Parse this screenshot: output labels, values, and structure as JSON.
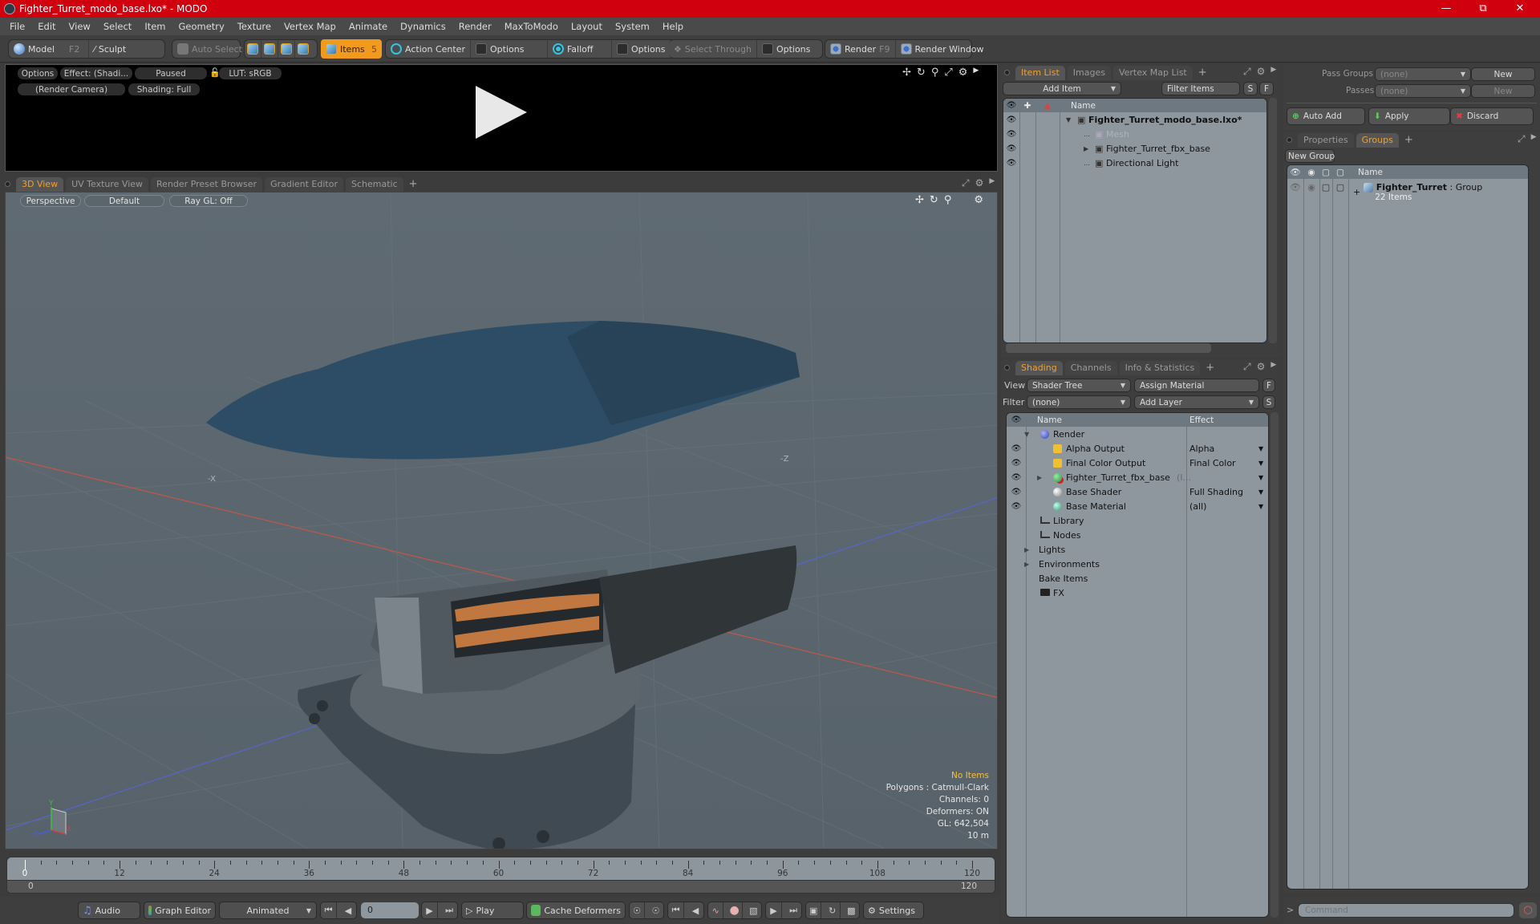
{
  "window": {
    "title": "Fighter_Turret_modo_base.lxo* - MODO",
    "controls": [
      "minimize",
      "restore",
      "close"
    ]
  },
  "menu": [
    "File",
    "Edit",
    "View",
    "Select",
    "Item",
    "Geometry",
    "Texture",
    "Vertex Map",
    "Animate",
    "Dynamics",
    "Render",
    "MaxToModo",
    "Layout",
    "System",
    "Help"
  ],
  "toolbar": {
    "model": {
      "label": "Model",
      "key": "F2"
    },
    "sculpt": {
      "label": "Sculpt"
    },
    "auto_select": "Auto Select",
    "items": {
      "label": "Items",
      "key": "5"
    },
    "action_center": "Action Center",
    "options1": "Options",
    "falloff": "Falloff",
    "options2": "Options",
    "select_through": "Select Through",
    "options3": "Options",
    "render": {
      "label": "Render",
      "key": "F9"
    },
    "render_window": "Render Window"
  },
  "render_preview": {
    "options": "Options",
    "effect": "Effect: (Shadi...",
    "paused": "Paused",
    "lut": "LUT: sRGB",
    "camera": "(Render Camera)",
    "shading": "Shading: Full"
  },
  "viewport_tabs": {
    "tabs": [
      "3D View",
      "UV Texture View",
      "Render Preset Browser",
      "Gradient Editor",
      "Schematic"
    ],
    "active": 0,
    "add": "+"
  },
  "viewport": {
    "projection": "Perspective",
    "style": "Default",
    "raygl": "Ray GL: Off",
    "axis_labels": {
      "x_neg": "-X",
      "z_neg": "-Z"
    },
    "gizmo": {
      "x": "X",
      "y": "Y",
      "z": "Z"
    },
    "stats": {
      "selection": "No Items",
      "polygons": "Polygons : Catmull-Clark",
      "channels": "Channels: 0",
      "deformers": "Deformers: ON",
      "gl": "GL: 642,504",
      "scale": "10 m"
    },
    "colors": {
      "selection_text": "#f5c040",
      "x_axis": "#d05040",
      "z_axis": "#5060d0"
    }
  },
  "timeline": {
    "labels": [
      "0",
      "12",
      "24",
      "36",
      "48",
      "60",
      "72",
      "84",
      "96",
      "108",
      "120"
    ],
    "range_start": "0",
    "range_end": "120",
    "current_frame": 0,
    "max_frame": 120
  },
  "transport": {
    "audio": "Audio",
    "graph_editor": "Graph Editor",
    "animated": "Animated",
    "frame_value": "0",
    "play": "Play",
    "cache_deformers": "Cache Deformers",
    "settings": "Settings"
  },
  "item_list": {
    "tabs": [
      "Item List",
      "Images",
      "Vertex Map List"
    ],
    "active": 0,
    "add_item": "Add Item",
    "filter": "Filter Items",
    "s": "S",
    "f": "F",
    "column_name": "Name",
    "items": [
      {
        "name": "Fighter_Turret_modo_base.lxo*",
        "bold": true,
        "expanded": true,
        "depth": 0
      },
      {
        "name": "Mesh",
        "dim": true,
        "depth": 1
      },
      {
        "name": "Fighter_Turret_fbx_base",
        "collapsed": true,
        "depth": 1
      },
      {
        "name": "Directional Light",
        "depth": 1
      }
    ]
  },
  "shading": {
    "tabs": [
      "Shading",
      "Channels",
      "Info & Statistics"
    ],
    "active": 0,
    "view_label": "View",
    "view_value": "Shader Tree",
    "assign_material": "Assign Material",
    "f": "F",
    "filter_label": "Filter",
    "filter_value": "(none)",
    "add_layer": "Add Layer",
    "s": "S",
    "col_name": "Name",
    "col_effect": "Effect",
    "rows": [
      {
        "name": "Render",
        "effect": "",
        "icon": "render-sphere",
        "eye": false,
        "depth": 0,
        "expanded": true
      },
      {
        "name": "Alpha Output",
        "effect": "Alpha",
        "icon": "output",
        "eye": true,
        "depth": 1
      },
      {
        "name": "Final Color Output",
        "effect": "Final Color",
        "icon": "output",
        "eye": true,
        "depth": 1
      },
      {
        "name": "Fighter_Turret_fbx_base",
        "suffix": "(I...",
        "effect": "",
        "icon": "material-group",
        "eye": true,
        "depth": 1,
        "collapsed": true
      },
      {
        "name": "Base Shader",
        "effect": "Full Shading",
        "icon": "shader",
        "eye": true,
        "depth": 1
      },
      {
        "name": "Base Material",
        "effect": "(all)",
        "icon": "material",
        "eye": true,
        "depth": 1
      },
      {
        "name": "Library",
        "effect": "",
        "icon": "folder",
        "eye": false,
        "depth": 0
      },
      {
        "name": "Nodes",
        "effect": "",
        "icon": "folder",
        "eye": false,
        "depth": 0
      },
      {
        "name": "Lights",
        "effect": "",
        "icon": "",
        "eye": false,
        "depth": -1,
        "collapsed": true
      },
      {
        "name": "Environments",
        "effect": "",
        "icon": "",
        "eye": false,
        "depth": -1,
        "collapsed": true
      },
      {
        "name": "Bake Items",
        "effect": "",
        "icon": "",
        "eye": false,
        "depth": -1
      },
      {
        "name": "FX",
        "effect": "",
        "icon": "clapper",
        "eye": false,
        "depth": 0
      }
    ]
  },
  "pass_groups": {
    "pass_groups_label": "Pass Groups",
    "pass_groups_value": "(none)",
    "new1": "New",
    "passes_label": "Passes",
    "passes_value": "(none)",
    "new2": "New",
    "auto_add": "Auto Add",
    "apply": "Apply",
    "discard": "Discard"
  },
  "groups": {
    "tabs": [
      "Properties",
      "Groups"
    ],
    "active": 1,
    "new_group": "New Group",
    "col_name": "Name",
    "group_name": "Fighter_Turret",
    "group_type": " : Group",
    "group_count": "22 Items"
  },
  "command": {
    "placeholder": "Command",
    "prompt": ">"
  }
}
